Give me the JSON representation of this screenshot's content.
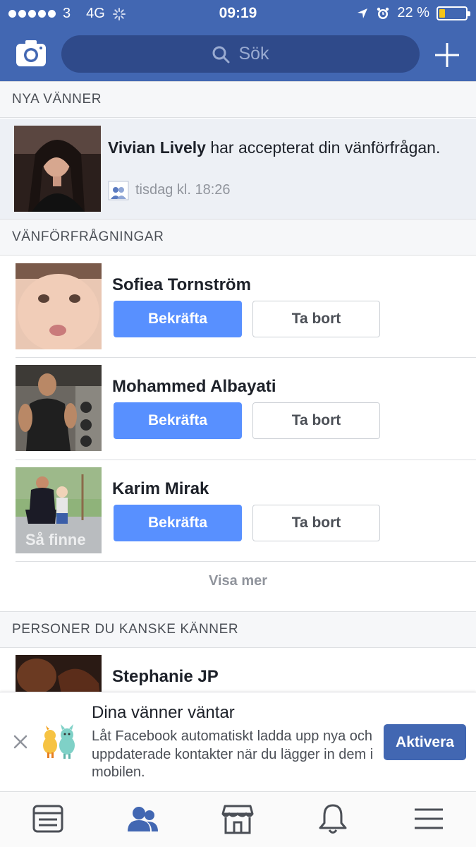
{
  "status_bar": {
    "carrier": "3",
    "network": "4G",
    "time": "09:19",
    "battery_percent_label": "22 %",
    "battery_level": 0.22
  },
  "header": {
    "search_placeholder": "Sök",
    "camera_icon": "camera-icon",
    "add_icon": "plus-icon"
  },
  "new_friends": {
    "section_title": "NYA VÄNNER",
    "item": {
      "name": "Vivian Lively",
      "message": " har accepterat din vänförfrågan.",
      "time": "tisdag kl. 18:26"
    }
  },
  "friend_requests": {
    "section_title": "VÄNFÖRFRÅGNINGAR",
    "confirm_label": "Bekräfta",
    "remove_label": "Ta bort",
    "items": [
      {
        "name": "Sofiea Tornström"
      },
      {
        "name": "Mohammed Albayati"
      },
      {
        "name": "Karim Mirak",
        "photo_caption": "Så finne"
      }
    ],
    "show_more_label": "Visa mer"
  },
  "people_you_may_know": {
    "section_title": "PERSONER DU KANSKE KÄNNER",
    "items": [
      {
        "name": "Stephanie JP"
      }
    ]
  },
  "contacts_banner": {
    "title": "Dina vänner väntar",
    "body": "Låt Facebook automatiskt ladda upp nya och uppdaterade kontakter när du lägger in dem i mobilen.",
    "button_label": "Aktivera"
  },
  "tab_bar": {
    "tabs": [
      "news-feed-icon",
      "friends-icon",
      "marketplace-icon",
      "notifications-icon",
      "menu-icon"
    ],
    "active": "friends-icon"
  },
  "colors": {
    "brand": "#4267b2",
    "confirm": "#5890ff",
    "section_bg": "#f6f7f9"
  }
}
